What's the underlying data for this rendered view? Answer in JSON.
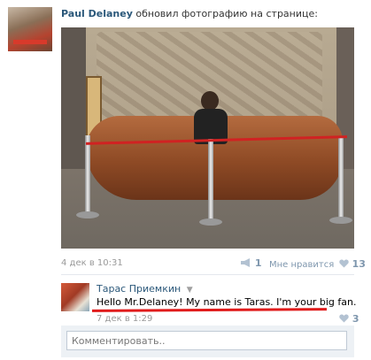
{
  "post": {
    "author": "Paul Delaney",
    "action": "обновил фотографию на странице:",
    "date": "4 дек в 10:31",
    "share_count": "1",
    "like_label": "Мне нравится",
    "like_count": "13"
  },
  "comment": {
    "author": "Тарас Приемкин",
    "text": "Hello Mr.Delaney! My name is Taras. I'm your big fan.",
    "date": "7 дек в 1:29",
    "like_count": "3"
  },
  "comment_input": {
    "placeholder": "Комментировать.."
  },
  "icons": {
    "share": "megaphone-icon",
    "like": "heart-icon",
    "author_menu": "chevron-down-icon"
  },
  "colors": {
    "link": "#2b587a",
    "meta": "#999999",
    "action": "#7f97ae",
    "annotation": "#e01b1b"
  }
}
